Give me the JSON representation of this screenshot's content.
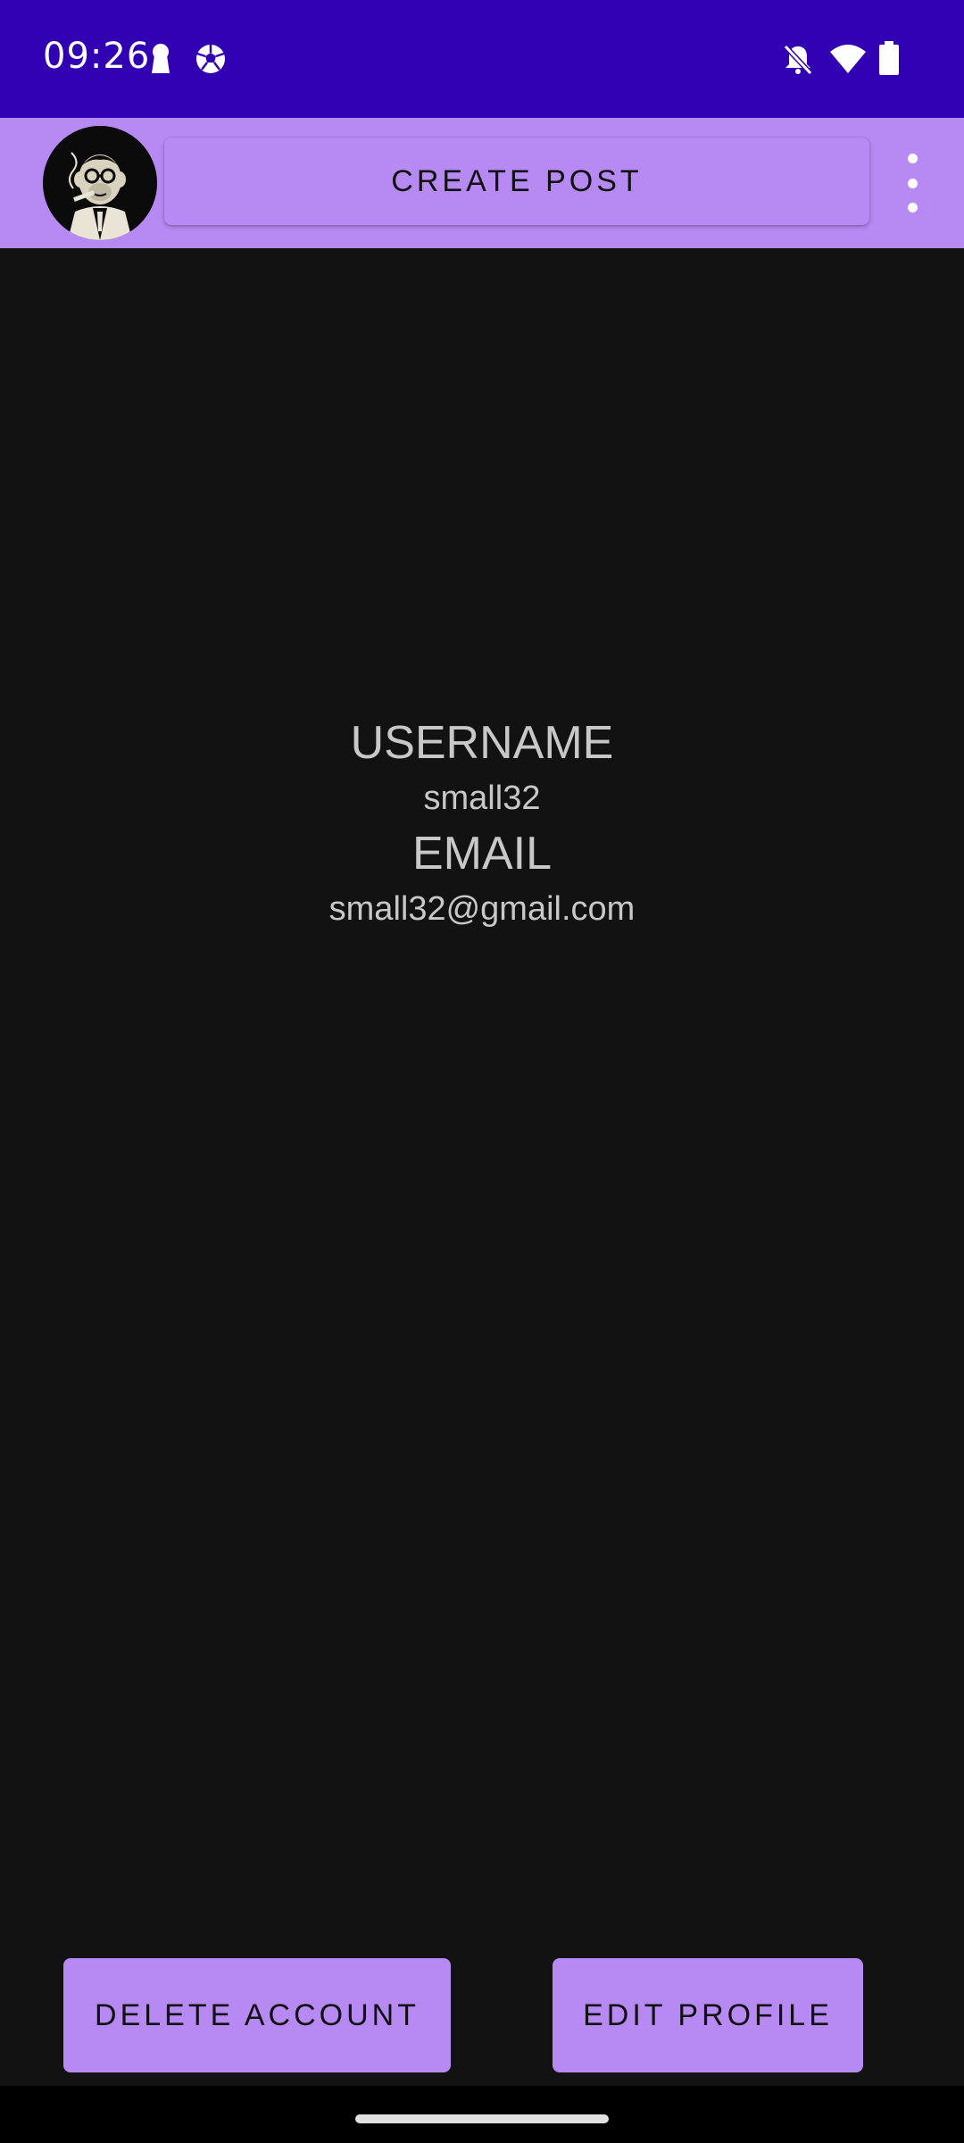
{
  "status_bar": {
    "time": "09:26",
    "background": "#3100b2",
    "left_icons": [
      "keyhole-icon",
      "soccer-ball-icon"
    ],
    "right_icons": [
      "bell-off-icon",
      "wifi-icon",
      "battery-icon"
    ]
  },
  "app_bar": {
    "background": "#b689f3",
    "avatar_icon": "monkey-avatar",
    "create_post_label": "CREATE POST",
    "menu_icon": "more-vert-icon"
  },
  "profile": {
    "username_label": "USERNAME",
    "username_value": "small32",
    "email_label": "EMAIL",
    "email_value": "small32@gmail.com"
  },
  "actions": {
    "delete_label": "DELETE ACCOUNT",
    "edit_label": "EDIT PROFILE",
    "accent": "#b689f3"
  }
}
